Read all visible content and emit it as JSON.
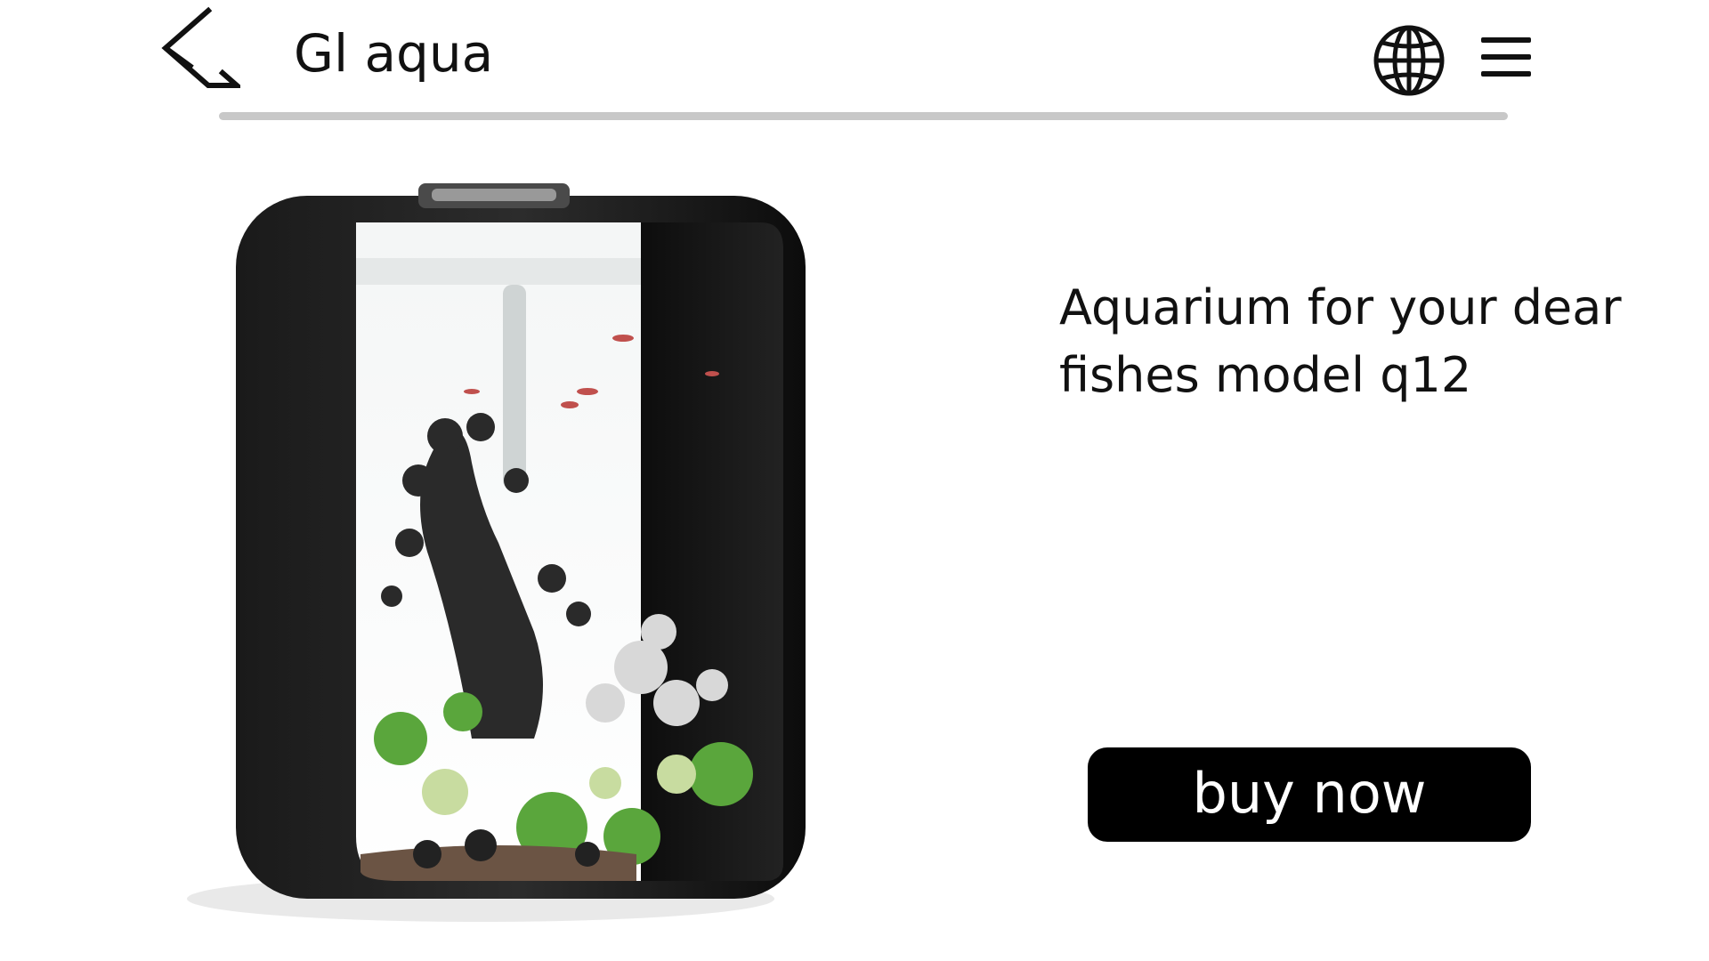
{
  "header": {
    "brand": "Gl aqua",
    "icons": {
      "back": "back-arrow-icon",
      "language": "globe-icon",
      "menu": "hamburger-menu-icon"
    }
  },
  "product": {
    "title": "Aquarium for your dear fishes model q12",
    "image_alt": "Black aquarium with corals, plants and fish",
    "buy_label": "buy now"
  },
  "colors": {
    "button_bg": "#000000",
    "button_text": "#ffffff",
    "divider": "#c8c8c8"
  }
}
